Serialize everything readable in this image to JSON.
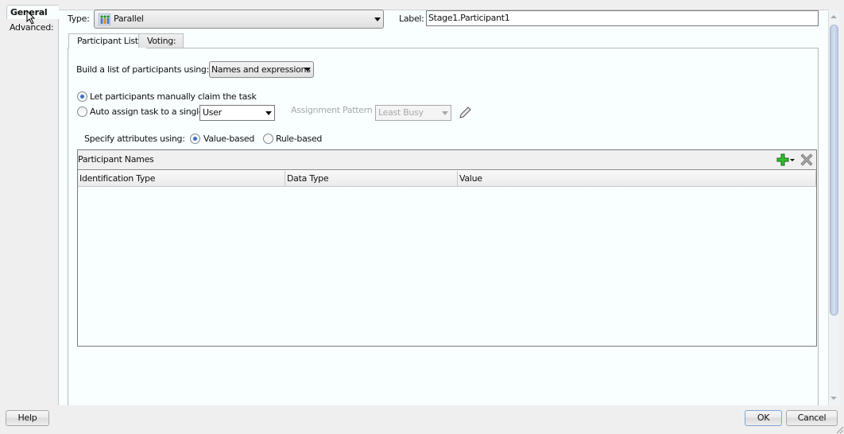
{
  "nav": {
    "tabs": [
      {
        "label": "General",
        "selected": true
      },
      {
        "label": "Advanced:",
        "selected": false
      }
    ]
  },
  "type_field": {
    "label": "Type:",
    "value": "Parallel",
    "icon": "parallel-participants-icon"
  },
  "label_field": {
    "label": "Label:",
    "value": "Stage1.Participant1"
  },
  "subtabs": [
    {
      "label": "Participant List",
      "selected": true
    },
    {
      "label": "Voting:",
      "selected": false
    }
  ],
  "build_list": {
    "label": "Build a list of participants using:",
    "value": "Names and expressions"
  },
  "assignment": {
    "option_manual": {
      "label": "Let participants manually claim the task",
      "selected": true
    },
    "option_auto": {
      "label": "Auto assign task to a single",
      "selected": false
    },
    "auto_select_value": "User",
    "pattern_label": "Assignment Pattern :",
    "pattern_value": "Least Busy",
    "edit_icon": "pencil-icon"
  },
  "attributes": {
    "label": "Specify attributes using:",
    "options": [
      {
        "label": "Value-based",
        "selected": true
      },
      {
        "label": "Rule-based",
        "selected": false
      }
    ]
  },
  "table": {
    "title": "Participant Names",
    "add_icon": "add-icon",
    "delete_icon": "delete-icon",
    "columns": [
      "Identification Type",
      "Data Type",
      "Value"
    ],
    "rows": []
  },
  "footer": {
    "help": "Help",
    "ok": "OK",
    "cancel": "Cancel"
  }
}
